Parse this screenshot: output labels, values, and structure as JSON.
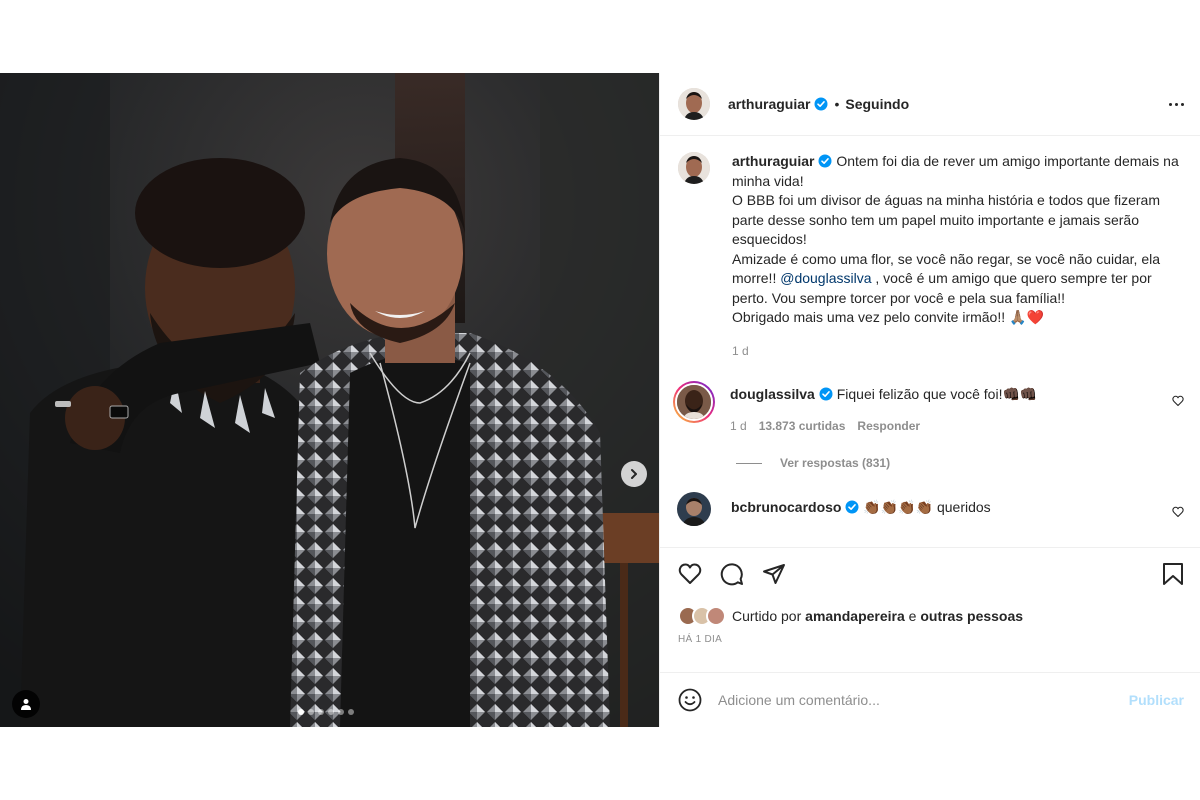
{
  "post": {
    "author": "arthuraguiar",
    "follow_status": "Seguindo",
    "separator": "•"
  },
  "caption": {
    "author": "arthuraguiar",
    "text_before_mention": "Ontem foi dia de rever um amigo importante demais na minha vida!\nO BBB foi um divisor de águas na minha história e todos que fizeram parte desse sonho tem um papel muito importante e jamais serão esquecidos!\nAmizade é como uma flor, se você não regar, se você não cuidar, ela morre!! ",
    "mention": "@douglassilva",
    "text_after_mention": " , você é um amigo que quero sempre ter por perto. Vou sempre torcer por você e pela sua família!!\nObrigado mais uma vez pelo convite irmão!! 🙏🏽❤️",
    "time": "1 d"
  },
  "comments": [
    {
      "author": "douglassilva",
      "text": "Fiquei felizão que você foi!👊🏿👊🏿",
      "time": "1 d",
      "likes": "13.873 curtidas",
      "reply_label": "Responder",
      "view_replies": "Ver respostas (831)"
    },
    {
      "author": "bcbrunocardoso",
      "text": "👏🏾👏🏾👏🏾👏🏾 queridos"
    }
  ],
  "likes": {
    "prefix": "Curtido por",
    "user": "amandapereira",
    "conjunction": "e",
    "others": "outras pessoas"
  },
  "time_ago": "HÁ 1 DIA",
  "add_comment": {
    "placeholder": "Adicione um comentário...",
    "publish_label": "Publicar"
  },
  "carousel": {
    "count": 6,
    "active_index": 0
  },
  "colors": {
    "link": "#00376b",
    "publish_disabled": "#b2dffc",
    "secondary_text": "#8e8e8e",
    "heart_red": "#ed4956"
  },
  "icons": [
    "verified-badge-icon",
    "more-options-icon",
    "heart-icon",
    "comment-icon",
    "share-icon",
    "bookmark-icon",
    "emoji-icon",
    "chevron-right-icon",
    "user-tag-icon"
  ]
}
